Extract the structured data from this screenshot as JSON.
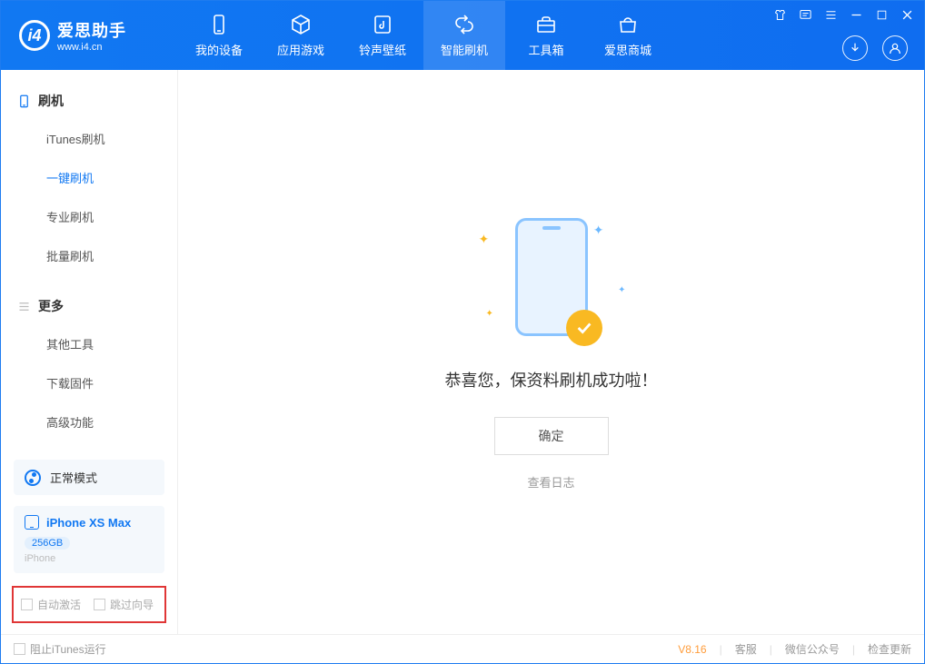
{
  "logo": {
    "cn": "爱思助手",
    "url": "www.i4.cn"
  },
  "nav": {
    "device": "我的设备",
    "apps": "应用游戏",
    "rings": "铃声壁纸",
    "flash": "智能刷机",
    "tools": "工具箱",
    "store": "爱思商城"
  },
  "sidebar": {
    "group1": {
      "title": "刷机",
      "items": [
        "iTunes刷机",
        "一键刷机",
        "专业刷机",
        "批量刷机"
      ]
    },
    "group2": {
      "title": "更多",
      "items": [
        "其他工具",
        "下载固件",
        "高级功能"
      ]
    },
    "mode": "正常模式",
    "device": {
      "name": "iPhone XS Max",
      "storage": "256GB",
      "type": "iPhone"
    },
    "checkboxes": {
      "auto_activate": "自动激活",
      "skip_guide": "跳过向导"
    }
  },
  "main": {
    "success": "恭喜您，保资料刷机成功啦！",
    "ok": "确定",
    "log": "查看日志"
  },
  "footer": {
    "block_itunes": "阻止iTunes运行",
    "version": "V8.16",
    "support": "客服",
    "wechat": "微信公众号",
    "update": "检查更新"
  }
}
